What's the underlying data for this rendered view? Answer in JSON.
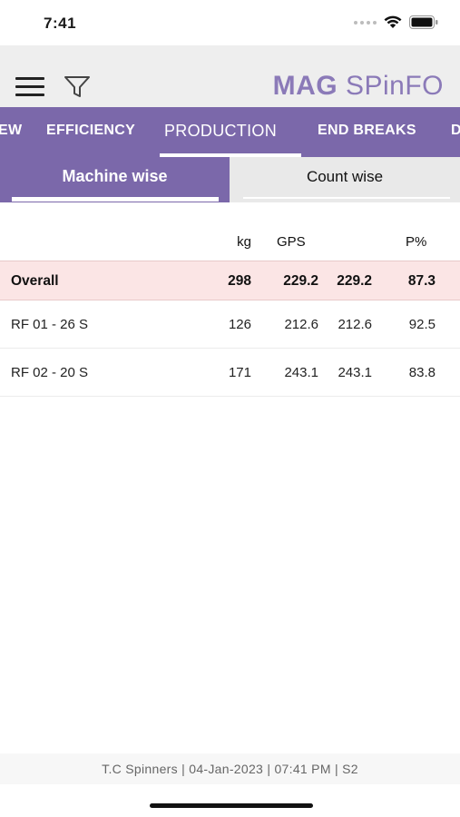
{
  "status_bar": {
    "time": "7:41"
  },
  "header": {
    "logo_bold": "MAG",
    "logo_rest": "SPinFO"
  },
  "tabs": [
    {
      "label": "EW"
    },
    {
      "label": "EFFICIENCY"
    },
    {
      "label": "PRODUCTION",
      "active": true
    },
    {
      "label": "END BREAKS"
    },
    {
      "label": "D"
    }
  ],
  "segment": {
    "machine_wise": "Machine wise",
    "count_wise": "Count wise",
    "selected": "Machine wise"
  },
  "table": {
    "columns": [
      "",
      "kg",
      "GPS",
      "",
      "P%"
    ],
    "overall": {
      "name": "Overall",
      "kg": "298",
      "gps": "229.2",
      "gps2": "229.2",
      "p": "87.3"
    },
    "rows": [
      {
        "name": "RF 01 - 26 S",
        "kg": "126",
        "gps": "212.6",
        "gps2": "212.6",
        "p": "92.5"
      },
      {
        "name": "RF 02 - 20 S",
        "kg": "171",
        "gps": "243.1",
        "gps2": "243.1",
        "p": "83.8"
      }
    ]
  },
  "footer": {
    "text": "T.C Spinners | 04-Jan-2023 | 07:41 PM | S2"
  },
  "colors": {
    "accent": "#7b68aa",
    "logo": "#8b7ab8",
    "overall_row": "#fbe5e5"
  }
}
